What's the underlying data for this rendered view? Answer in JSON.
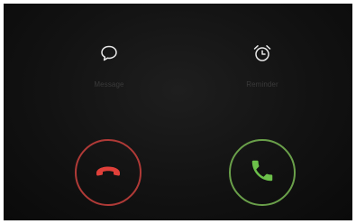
{
  "quick_actions": {
    "message": {
      "label": "Message",
      "icon": "message-bubble-icon"
    },
    "reminder": {
      "label": "Reminder",
      "icon": "alarm-clock-icon"
    }
  },
  "call_controls": {
    "decline": {
      "icon": "phone-hangup-icon",
      "color": "#e0403a",
      "ring_color": "#b03a37"
    },
    "answer": {
      "icon": "phone-answer-icon",
      "color": "#6cc04a",
      "ring_color": "#6aa04a"
    }
  },
  "colors": {
    "background": "#121212",
    "label_text": "#3a3a3a",
    "icon": "#e8e8e8"
  }
}
